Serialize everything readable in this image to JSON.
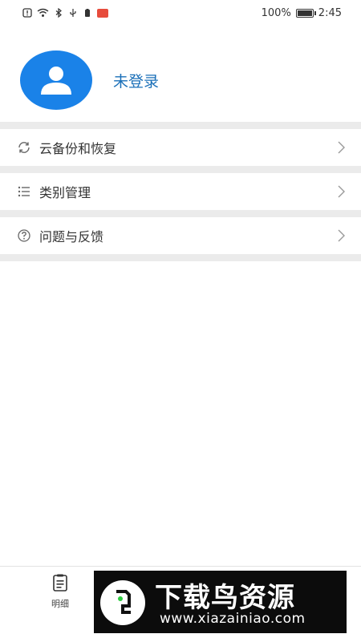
{
  "status_bar": {
    "battery_percent": "100%",
    "time": "2:45"
  },
  "profile": {
    "login_status": "未登录"
  },
  "menu": {
    "items": [
      {
        "label": "云备份和恢复",
        "icon": "sync-icon"
      },
      {
        "label": "类别管理",
        "icon": "list-icon"
      },
      {
        "label": "问题与反馈",
        "icon": "question-circle-icon"
      }
    ]
  },
  "bottom_nav": {
    "tabs": [
      {
        "label": "明细",
        "icon": "document-list-icon"
      }
    ]
  },
  "watermark": {
    "title": "下载鸟资源",
    "url": "www.xiazainiao.com"
  },
  "colors": {
    "accent": "#1a82e8",
    "login_text": "#1a6fb8",
    "divider": "#ebebeb"
  }
}
